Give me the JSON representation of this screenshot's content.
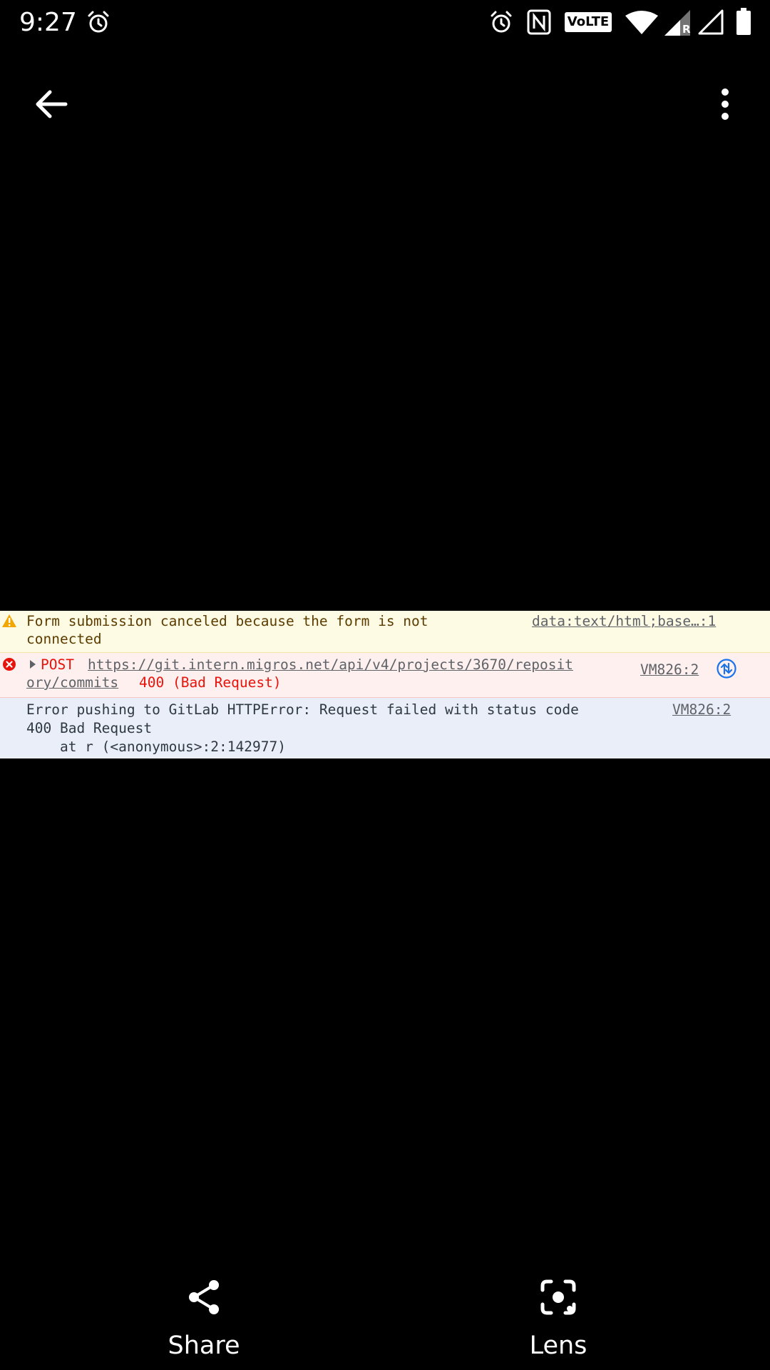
{
  "status_bar": {
    "time": "9:27",
    "volte_label": "VoLTE",
    "roaming_label": "R",
    "icons": [
      "alarm-icon",
      "alarm-icon",
      "nfc-icon",
      "volte-icon",
      "wifi-icon",
      "signal-icon",
      "signal-icon",
      "battery-icon"
    ]
  },
  "app_bar": {
    "back_icon": "arrow-back-icon",
    "menu_icon": "more-vert-icon"
  },
  "console": {
    "warning": {
      "line1": "Form submission canceled because the form is not",
      "line2": "connected",
      "source": "data:text/html;base…:1"
    },
    "error": {
      "method": "POST",
      "url_line1": "https://git.intern.migros.net/api/v4/projects/3670/reposit",
      "url_line2": "ory/commits",
      "status": "400 (Bad Request)",
      "source": "VM826:2"
    },
    "info": {
      "line1": "Error pushing to GitLab HTTPError: Request failed with status code",
      "line2": "400 Bad Request",
      "line3": "    at r (<anonymous>:2:142977)",
      "source": "VM826:2"
    }
  },
  "actions": {
    "share_label": "Share",
    "lens_label": "Lens"
  },
  "colors": {
    "background": "#000000",
    "warning_bg": "#fefbe5",
    "error_bg": "#fdf0ef",
    "info_bg": "#e9eef9",
    "error_text": "#e8140b"
  }
}
